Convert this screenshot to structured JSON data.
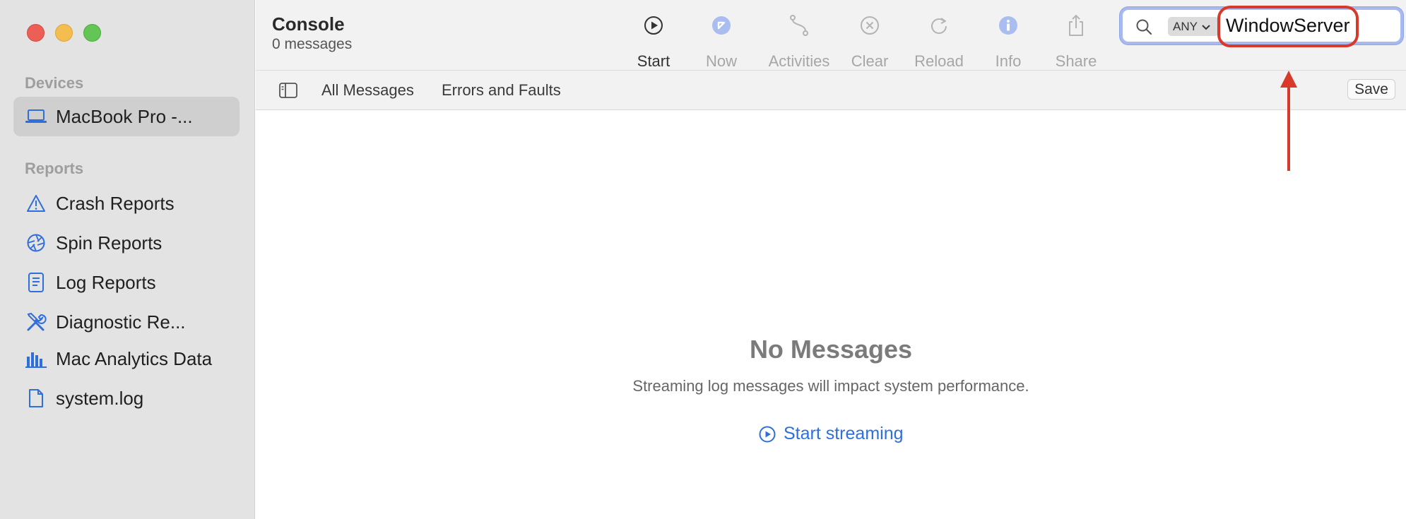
{
  "window": {
    "title": "Console",
    "subtitle": "0 messages"
  },
  "sidebar": {
    "devices_heading": "Devices",
    "device": {
      "label": "MacBook Pro -...",
      "icon": "laptop-icon"
    },
    "reports_heading": "Reports",
    "items": [
      {
        "label": "Crash Reports",
        "icon": "warning-triangle-icon"
      },
      {
        "label": "Spin Reports",
        "icon": "spin-aperture-icon"
      },
      {
        "label": "Log Reports",
        "icon": "document-list-icon"
      },
      {
        "label": "Diagnostic Re...",
        "icon": "wrench-screwdriver-icon"
      },
      {
        "label": "Mac Analytics Data",
        "icon": "bar-chart-icon"
      },
      {
        "label": "system.log",
        "icon": "file-icon"
      }
    ]
  },
  "toolbar": {
    "buttons": [
      {
        "label": "Start",
        "icon": "play-circle-icon",
        "enabled": true
      },
      {
        "label": "Now",
        "icon": "now-arrow-icon",
        "enabled": false
      },
      {
        "label": "Activities",
        "icon": "activities-icon",
        "enabled": false
      },
      {
        "label": "Clear",
        "icon": "clear-x-circle-icon",
        "enabled": false
      },
      {
        "label": "Reload",
        "icon": "reload-icon",
        "enabled": false
      },
      {
        "label": "Info",
        "icon": "info-icon",
        "enabled": false
      },
      {
        "label": "Share",
        "icon": "share-icon",
        "enabled": false
      }
    ]
  },
  "search": {
    "scope": "ANY",
    "query": "WindowServer"
  },
  "filterbar": {
    "all_messages": "All Messages",
    "errors_faults": "Errors and Faults",
    "save_label": "Save"
  },
  "main": {
    "empty_title": "No Messages",
    "empty_subtitle": "Streaming log messages will impact system performance.",
    "start_streaming": "Start streaming"
  },
  "colors": {
    "accent": "#2f6fdc",
    "annotation": "#d8392b",
    "search_focus": "#a7b9ee"
  }
}
